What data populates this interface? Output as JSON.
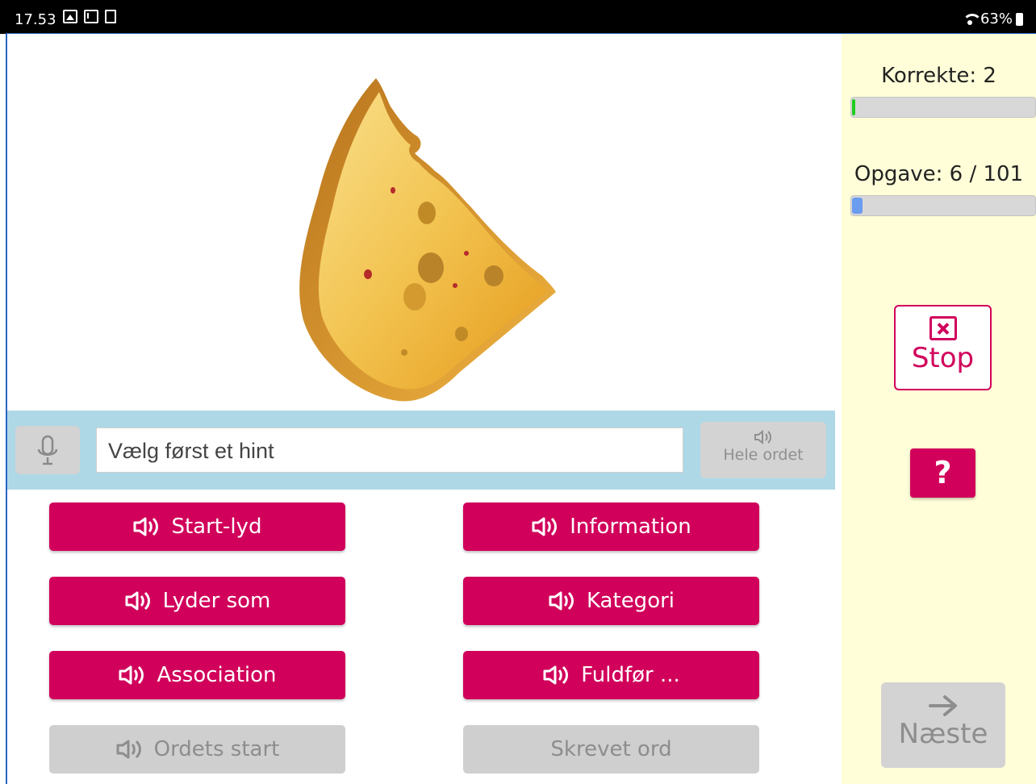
{
  "status_bar": {
    "time": "17.53",
    "battery_percent": "63%",
    "icons": [
      "image-icon",
      "mail-icon",
      "screenshot-icon",
      "wifi-icon",
      "battery-icon"
    ]
  },
  "stage": {
    "image": "cheese-wedge"
  },
  "hint_bar": {
    "input_placeholder": "Vælg først et hint",
    "input_value": "",
    "whole_word_label": "Hele ordet"
  },
  "hint_buttons": [
    {
      "label": "Start-lyd",
      "enabled": true
    },
    {
      "label": "Information",
      "enabled": true
    },
    {
      "label": "Lyder som",
      "enabled": true
    },
    {
      "label": "Kategori",
      "enabled": true
    },
    {
      "label": "Association",
      "enabled": true
    },
    {
      "label": "Fuldfør ...",
      "enabled": true
    },
    {
      "label": "Ordets start",
      "enabled": false
    },
    {
      "label": "Skrevet ord",
      "enabled": false
    }
  ],
  "sidebar": {
    "correct_label": "Korrekte: 2",
    "correct_progress": 0.01,
    "task_label": "Opgave: 6 / 101",
    "task_progress": 0.059,
    "stop_label": "Stop",
    "help_label": "?",
    "next_label": "Næste"
  },
  "colors": {
    "accent": "#d1005b",
    "hint_bar": "#aed8e6",
    "sidebar_bg": "#fffed8",
    "correct_fill": "#22cc22",
    "task_fill": "#6a9cf0",
    "disabled": "#d3d3d3"
  }
}
